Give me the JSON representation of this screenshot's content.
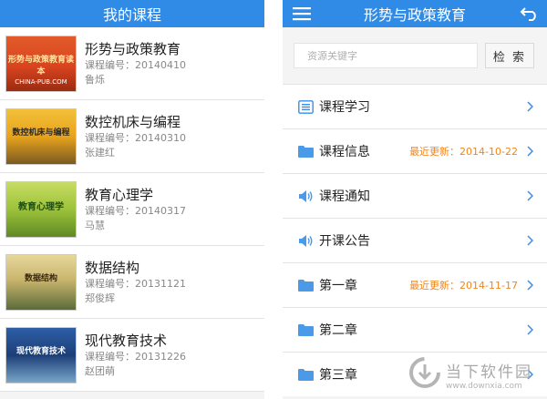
{
  "left_screen": {
    "title": "我的课程",
    "courses": [
      {
        "name": "形势与政策教育",
        "number": "课程编号：20140410",
        "teacher": "鲁烁",
        "cover_text": "形势与政策教育读本",
        "cover_sub": "CHINA-PUB.COM",
        "cover_color": "#d9441f"
      },
      {
        "name": "数控机床与编程",
        "number": "课程编号：20140310",
        "teacher": "张建红",
        "cover_text": "数控机床与编程",
        "cover_sub": "",
        "cover_color": "#e8a31c"
      },
      {
        "name": "教育心理学",
        "number": "课程编号：20140317",
        "teacher": "马慧",
        "cover_text": "教育心理学",
        "cover_sub": "",
        "cover_color": "#9cc23a"
      },
      {
        "name": "数据结构",
        "number": "课程编号：20131121",
        "teacher": "郑俊辉",
        "cover_text": "数据结构",
        "cover_sub": "",
        "cover_color": "#c9b56d"
      },
      {
        "name": "现代教育技术",
        "number": "课程编号：20131226",
        "teacher": "赵团萌",
        "cover_text": "现代教育技术",
        "cover_sub": "",
        "cover_color": "#1d3f78"
      }
    ]
  },
  "right_screen": {
    "title": "形势与政策教育",
    "search": {
      "placeholder": "资源关键字",
      "button": "检 索"
    },
    "menu": [
      {
        "icon": "list-icon",
        "label": "课程学习",
        "update": ""
      },
      {
        "icon": "folder-icon",
        "label": "课程信息",
        "update": "最近更新：2014-10-22"
      },
      {
        "icon": "speaker-icon",
        "label": "课程通知",
        "update": ""
      },
      {
        "icon": "speaker-icon",
        "label": "开课公告",
        "update": ""
      },
      {
        "icon": "folder-icon",
        "label": "第一章",
        "update": "最近更新：2014-11-17"
      },
      {
        "icon": "folder-icon",
        "label": "第二章",
        "update": ""
      },
      {
        "icon": "folder-icon",
        "label": "第三章",
        "update": ""
      }
    ]
  },
  "watermark": {
    "name": "当下软件园",
    "url": "www.downxia.com"
  },
  "colors": {
    "header_blue": "#2f8be6",
    "update_orange": "#f08519",
    "icon_blue": "#3a8ee6"
  }
}
